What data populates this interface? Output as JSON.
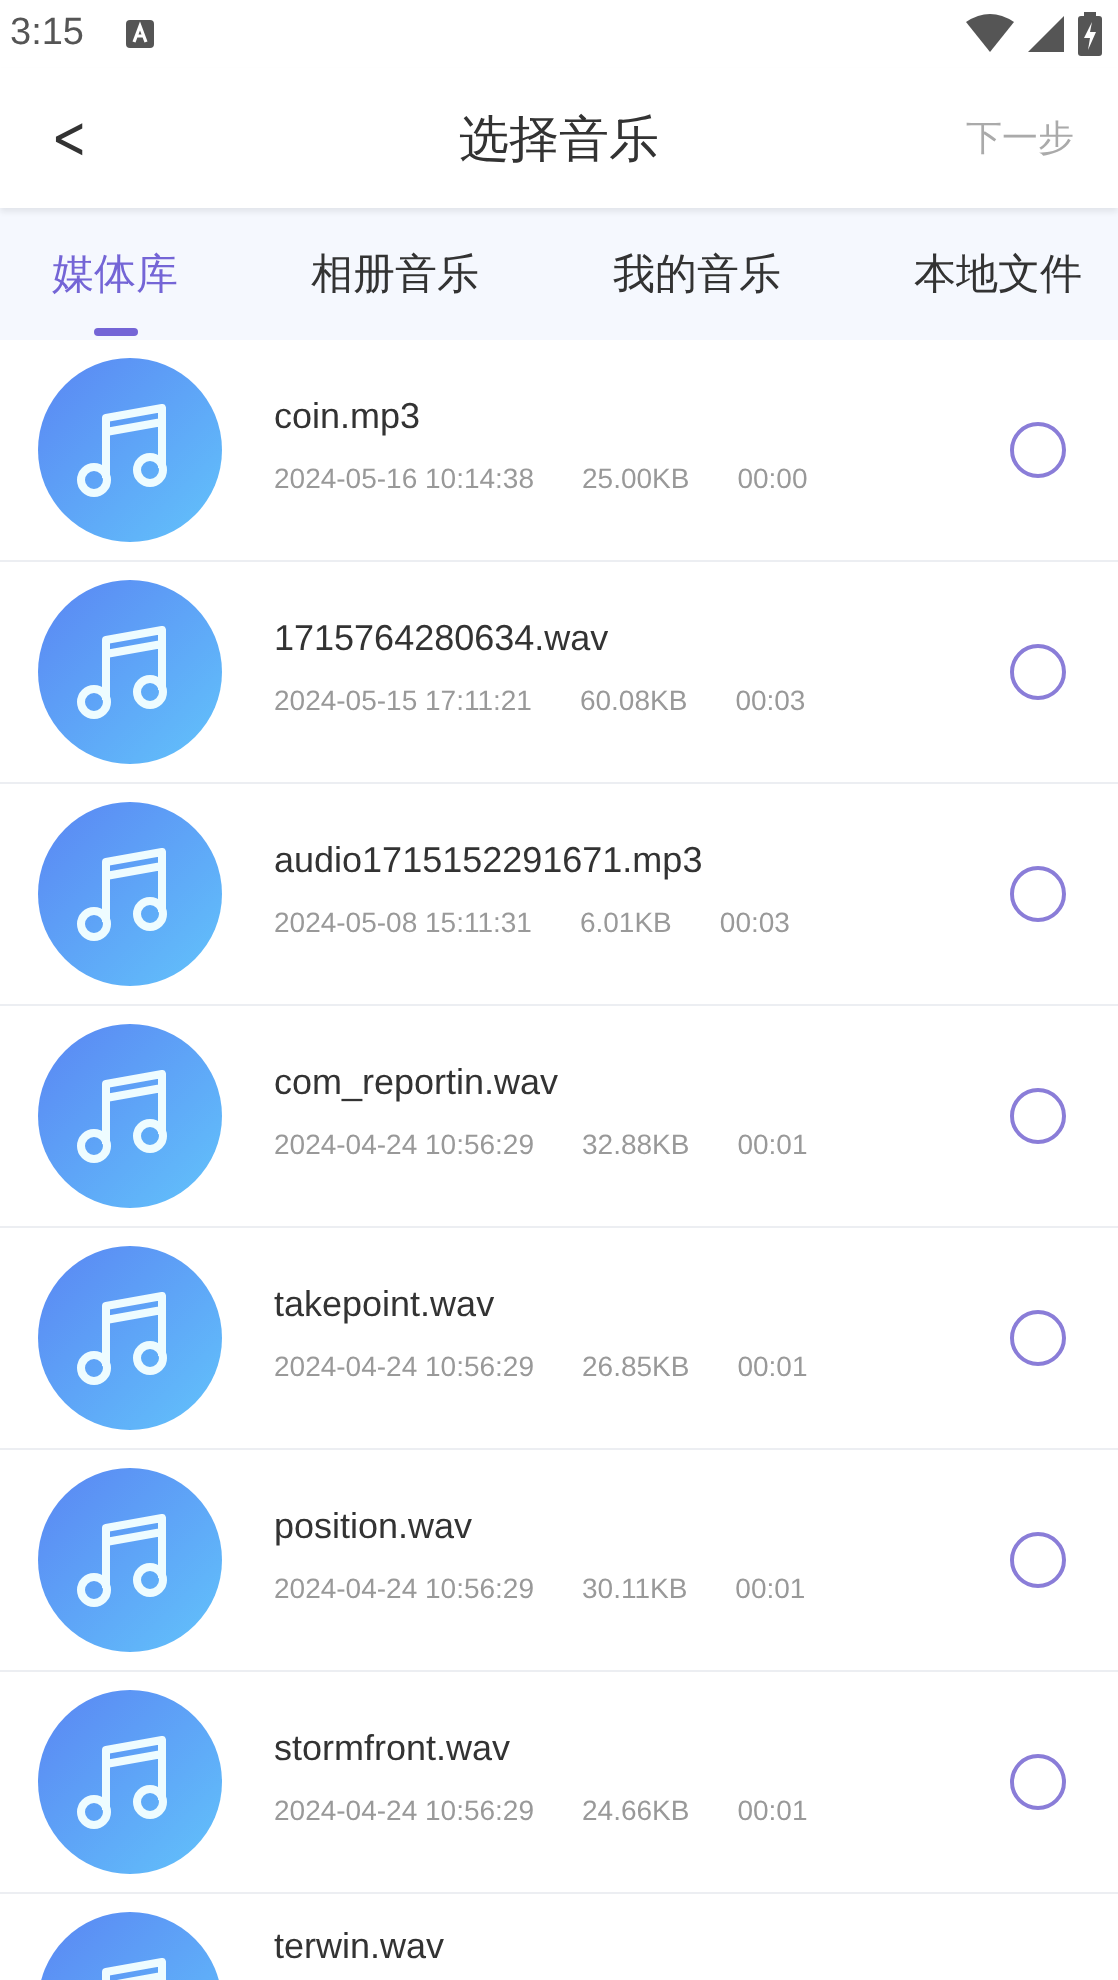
{
  "status_bar": {
    "time": "3:15"
  },
  "header": {
    "back": "<",
    "title": "选择音乐",
    "next": "下一步"
  },
  "tabs": [
    {
      "label": "媒体库",
      "selected": true
    },
    {
      "label": "相册音乐",
      "selected": false
    },
    {
      "label": "我的音乐",
      "selected": false
    },
    {
      "label": "本地文件",
      "selected": false
    }
  ],
  "files": [
    {
      "name": "coin.mp3",
      "date": "2024-05-16 10:14:38",
      "size": "25.00KB",
      "duration": "00:00",
      "selected": false
    },
    {
      "name": "1715764280634.wav",
      "date": "2024-05-15 17:11:21",
      "size": "60.08KB",
      "duration": "00:03",
      "selected": false
    },
    {
      "name": "audio1715152291671.mp3",
      "date": "2024-05-08 15:11:31",
      "size": "6.01KB",
      "duration": "00:03",
      "selected": false
    },
    {
      "name": "com_reportin.wav",
      "date": "2024-04-24 10:56:29",
      "size": "32.88KB",
      "duration": "00:01",
      "selected": false
    },
    {
      "name": "takepoint.wav",
      "date": "2024-04-24 10:56:29",
      "size": "26.85KB",
      "duration": "00:01",
      "selected": false
    },
    {
      "name": "position.wav",
      "date": "2024-04-24 10:56:29",
      "size": "30.11KB",
      "duration": "00:01",
      "selected": false
    },
    {
      "name": "stormfront.wav",
      "date": "2024-04-24 10:56:29",
      "size": "24.66KB",
      "duration": "00:01",
      "selected": false
    },
    {
      "name": "terwin.wav"
    }
  ]
}
